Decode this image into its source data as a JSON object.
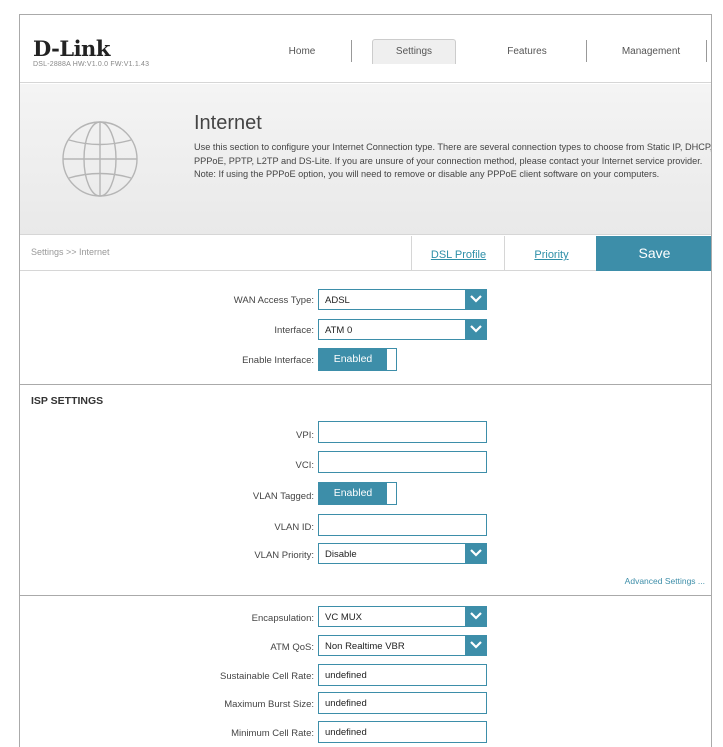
{
  "header": {
    "brand": "D-Link",
    "model_line": "DSL-2888A  HW:V1.0.0   FW:V1.1.43",
    "nav": [
      "Home",
      "Settings",
      "Features",
      "Management"
    ],
    "active_nav": "Settings"
  },
  "banner": {
    "title": "Internet",
    "description": "Use this section to configure your Internet Connection type. There are several connection types to choose from Static IP, DHCP, PPPoE, PPTP, L2TP and DS-Lite. If you are unsure of your connection method, please contact your Internet service provider. Note: If using the PPPoE option, you will need to remove or disable any PPPoE client software on your computers.",
    "icon": "globe-icon"
  },
  "crumbbar": {
    "breadcrumb": "Settings >> Internet",
    "dsl_profile": "DSL Profile",
    "priority": "Priority",
    "save": "Save"
  },
  "wan": {
    "access_type_label": "WAN Access Type:",
    "access_type_value": "ADSL",
    "interface_label": "Interface:",
    "interface_value": "ATM 0",
    "enable_label": "Enable Interface:",
    "enable_value": "Enabled"
  },
  "isp": {
    "heading": "ISP SETTINGS",
    "vpi_label": "VPI:",
    "vpi_value": "",
    "vci_label": "VCI:",
    "vci_value": "",
    "vlan_tagged_label": "VLAN Tagged:",
    "vlan_tagged_value": "Enabled",
    "vlan_id_label": "VLAN ID:",
    "vlan_id_value": "",
    "vlan_priority_label": "VLAN Priority:",
    "vlan_priority_value": "Disable",
    "advanced": "Advanced Settings ..."
  },
  "atm": {
    "encap_label": "Encapsulation:",
    "encap_value": "VC MUX",
    "qos_label": "ATM QoS:",
    "qos_value": "Non Realtime VBR",
    "scr_label": "Sustainable Cell Rate:",
    "scr_value": "undefined",
    "mbs_label": "Maximum Burst Size:",
    "mbs_value": "undefined",
    "mcr_label": "Minimum Cell Rate:",
    "mcr_value": "undefined"
  },
  "colors": {
    "accent": "#3d8ea9",
    "link": "#2e8fa8"
  }
}
